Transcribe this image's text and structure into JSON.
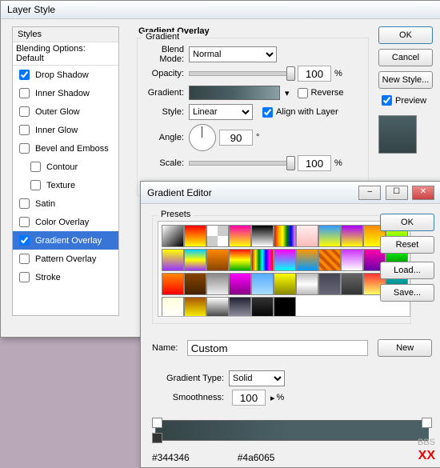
{
  "layerStyle": {
    "title": "Layer Style",
    "stylesHeader": "Styles",
    "blendingDefault": "Blending Options: Default",
    "items": [
      {
        "label": "Drop Shadow",
        "checked": true
      },
      {
        "label": "Inner Shadow",
        "checked": false
      },
      {
        "label": "Outer Glow",
        "checked": false
      },
      {
        "label": "Inner Glow",
        "checked": false
      },
      {
        "label": "Bevel and Emboss",
        "checked": false
      },
      {
        "label": "Contour",
        "checked": false,
        "indent": true
      },
      {
        "label": "Texture",
        "checked": false,
        "indent": true
      },
      {
        "label": "Satin",
        "checked": false
      },
      {
        "label": "Color Overlay",
        "checked": false
      },
      {
        "label": "Gradient Overlay",
        "checked": true,
        "selected": true
      },
      {
        "label": "Pattern Overlay",
        "checked": false
      },
      {
        "label": "Stroke",
        "checked": false
      }
    ],
    "section": {
      "title": "Gradient Overlay",
      "group": "Gradient",
      "blendModeLabel": "Blend Mode:",
      "blendMode": "Normal",
      "opacityLabel": "Opacity:",
      "opacity": "100",
      "pct": "%",
      "gradientLabel": "Gradient:",
      "reverse": "Reverse",
      "styleLabel": "Style:",
      "style": "Linear",
      "align": "Align with Layer",
      "angleLabel": "Angle:",
      "angle": "90",
      "deg": "°",
      "scaleLabel": "Scale:",
      "scale": "100"
    },
    "buttons": {
      "ok": "OK",
      "cancel": "Cancel",
      "newStyle": "New Style...",
      "preview": "Preview"
    }
  },
  "gradEditor": {
    "title": "Gradient Editor",
    "presetsLabel": "Presets",
    "presets": [
      "linear-gradient(135deg,#fff,#000)",
      "linear-gradient(#ff0000,#ffff00)",
      "repeating-conic-gradient(#ccc 0 25%,#fff 0 50%)",
      "linear-gradient(#f0a,#ff0)",
      "linear-gradient(#000,#fff)",
      "linear-gradient(90deg,red,orange,yellow,green,blue,violet)",
      "linear-gradient(#fee,#fbb)",
      "linear-gradient(#39f,#ff0)",
      "linear-gradient(#a0f,#ff0)",
      "linear-gradient(#f80,#ff0)",
      "linear-gradient(#ff0,#0f0)",
      "linear-gradient(#ff0,#93f)",
      "linear-gradient(#0cf,#ff0,#93f)",
      "linear-gradient(#f80,#840)",
      "linear-gradient(#f11,#ff0,#0a0)",
      "linear-gradient(90deg,red,yellow,green,cyan,blue,magenta,red)",
      "linear-gradient(#f0f,#0ff)",
      "linear-gradient(#f90,#09f)",
      "repeating-linear-gradient(45deg,#f80 0 4px,#c50 4px 8px)",
      "linear-gradient(#c3f,#fff)",
      "linear-gradient(#f0a,#60a)",
      "linear-gradient(#0f0,#060)",
      "linear-gradient(#f80,#f00)",
      "linear-gradient(#840,#420)",
      "linear-gradient(#888,#eee)",
      "linear-gradient(#f0f,#808)",
      "linear-gradient(#5af,#adf)",
      "linear-gradient(#ff0,#880)",
      "linear-gradient(#bbb,#fff,#bbb)",
      "linear-gradient(#445,#667)",
      "linear-gradient(#666,#333)",
      "linear-gradient(#f33,#ff6)",
      "linear-gradient(#0bb,#066)",
      "linear-gradient(#ffd,#fff)",
      "linear-gradient(#a50,#ff0)",
      "linear-gradient(#fff,#333)",
      "linear-gradient(#223,#99a)",
      "linear-gradient(#333,#000)",
      "linear-gradient(#000,#000)"
    ],
    "nameLabel": "Name:",
    "name": "Custom",
    "typeLabel": "Gradient Type:",
    "type": "Solid",
    "smoothLabel": "Smoothness:",
    "smooth": "100",
    "pct": "%",
    "buttons": {
      "ok": "OK",
      "reset": "Reset",
      "load": "Load...",
      "save": "Save...",
      "new": "New"
    },
    "hex1": "#344346",
    "hex2": "#4a6065",
    "xx": "XX"
  }
}
